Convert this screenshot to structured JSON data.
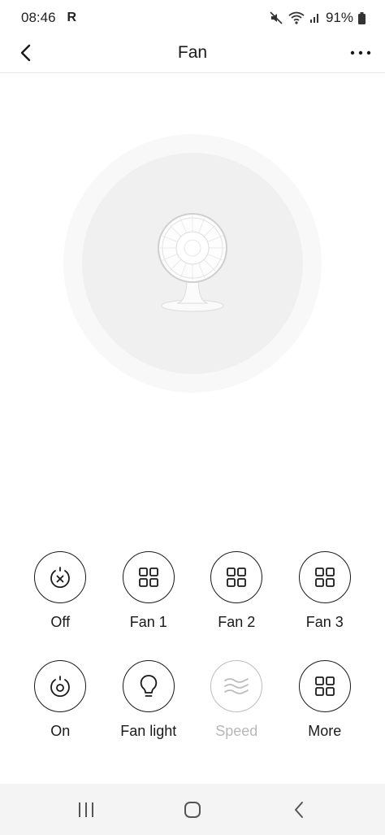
{
  "status_bar": {
    "time": "08:46",
    "carrier_icon": "R",
    "battery": "91%"
  },
  "header": {
    "title": "Fan",
    "back_icon": "chevron-left-icon",
    "menu_icon": "more-horizontal-icon"
  },
  "device": {
    "image": "desk-fan-image"
  },
  "controls": [
    {
      "label": "Off",
      "icon": "power-off-icon",
      "enabled": true
    },
    {
      "label": "Fan 1",
      "icon": "grid-icon",
      "enabled": true
    },
    {
      "label": "Fan 2",
      "icon": "grid-icon",
      "enabled": true
    },
    {
      "label": "Fan 3",
      "icon": "grid-icon",
      "enabled": true
    },
    {
      "label": "On",
      "icon": "power-on-icon",
      "enabled": true
    },
    {
      "label": "Fan light",
      "icon": "light-bulb-icon",
      "enabled": true
    },
    {
      "label": "Speed",
      "icon": "wind-icon",
      "enabled": false
    },
    {
      "label": "More",
      "icon": "grid-icon",
      "enabled": true
    }
  ],
  "nav_bar": {
    "recents_icon": "recents-icon",
    "home_icon": "home-icon",
    "back_icon": "back-icon"
  }
}
